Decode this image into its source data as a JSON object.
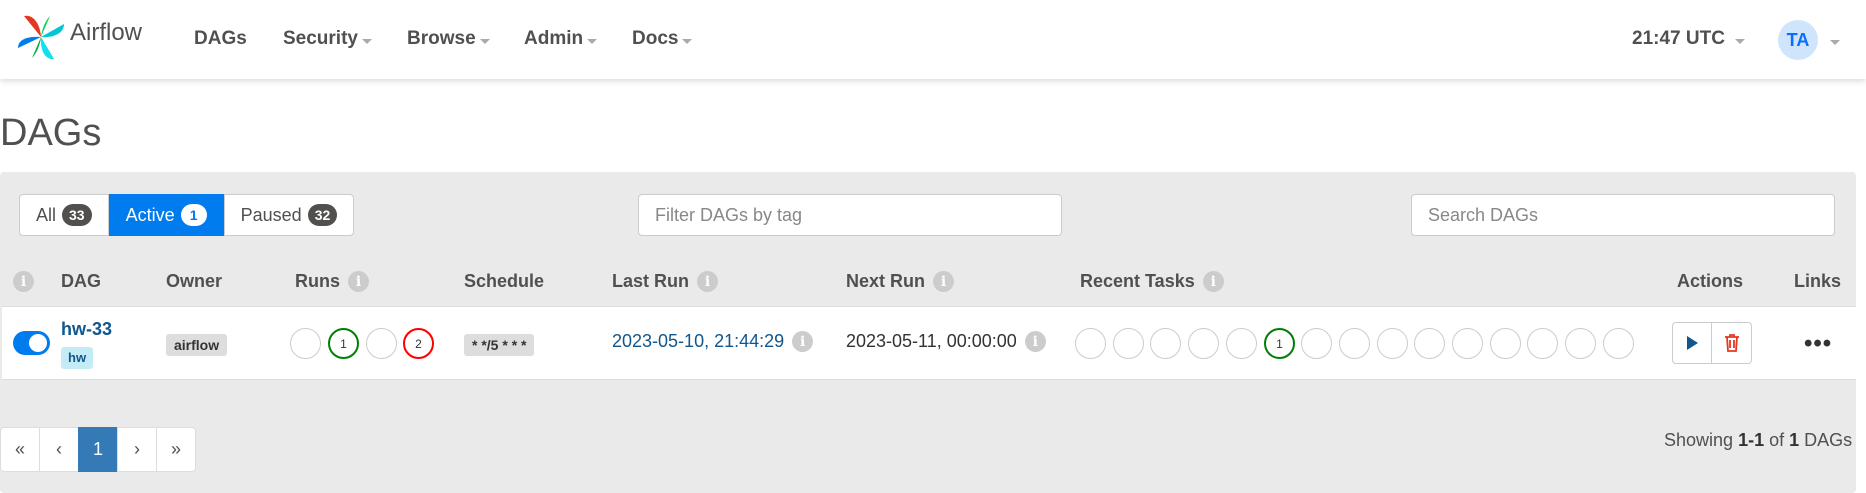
{
  "nav": {
    "brand": "Airflow",
    "items": [
      "DAGs",
      "Security",
      "Browse",
      "Admin",
      "Docs"
    ],
    "clock": "21:47 UTC",
    "avatar": "TA"
  },
  "page": {
    "title": "DAGs"
  },
  "filters": {
    "all_label": "All",
    "all_count": "33",
    "active_label": "Active",
    "active_count": "1",
    "paused_label": "Paused",
    "paused_count": "32",
    "tag_placeholder": "Filter DAGs by tag",
    "search_placeholder": "Search DAGs"
  },
  "table": {
    "headers": {
      "info": "i",
      "dag": "DAG",
      "owner": "Owner",
      "runs": "Runs",
      "schedule": "Schedule",
      "last_run": "Last Run",
      "next_run": "Next Run",
      "recent_tasks": "Recent Tasks",
      "actions": "Actions",
      "links": "Links"
    },
    "row": {
      "dag_id": "hw-33",
      "tag": "hw",
      "owner": "airflow",
      "runs": [
        "",
        "1",
        "",
        "2"
      ],
      "run_states": [
        "none",
        "success",
        "none",
        "failed"
      ],
      "schedule": "* */5 * * *",
      "last_run": "2023-05-10, 21:44:29",
      "next_run": "2023-05-11, 00:00:00",
      "recent_tasks": [
        "",
        "",
        "",
        "",
        "",
        "1",
        "",
        "",
        "",
        "",
        "",
        "",
        "",
        "",
        ""
      ],
      "recent_task_states": [
        "none",
        "none",
        "none",
        "none",
        "none",
        "success",
        "none",
        "none",
        "none",
        "none",
        "none",
        "none",
        "none",
        "none",
        "none"
      ],
      "links": "•••"
    }
  },
  "pagination": {
    "first": "«",
    "prev": "‹",
    "current": "1",
    "next": "›",
    "last": "»"
  },
  "summary": {
    "prefix": "Showing",
    "range": "1-1",
    "of": "of",
    "total": "1",
    "suffix": "DAGs"
  },
  "colors": {
    "primary": "#017cee",
    "success": "#008000",
    "failed": "#ff0000",
    "link": "#11568c"
  }
}
